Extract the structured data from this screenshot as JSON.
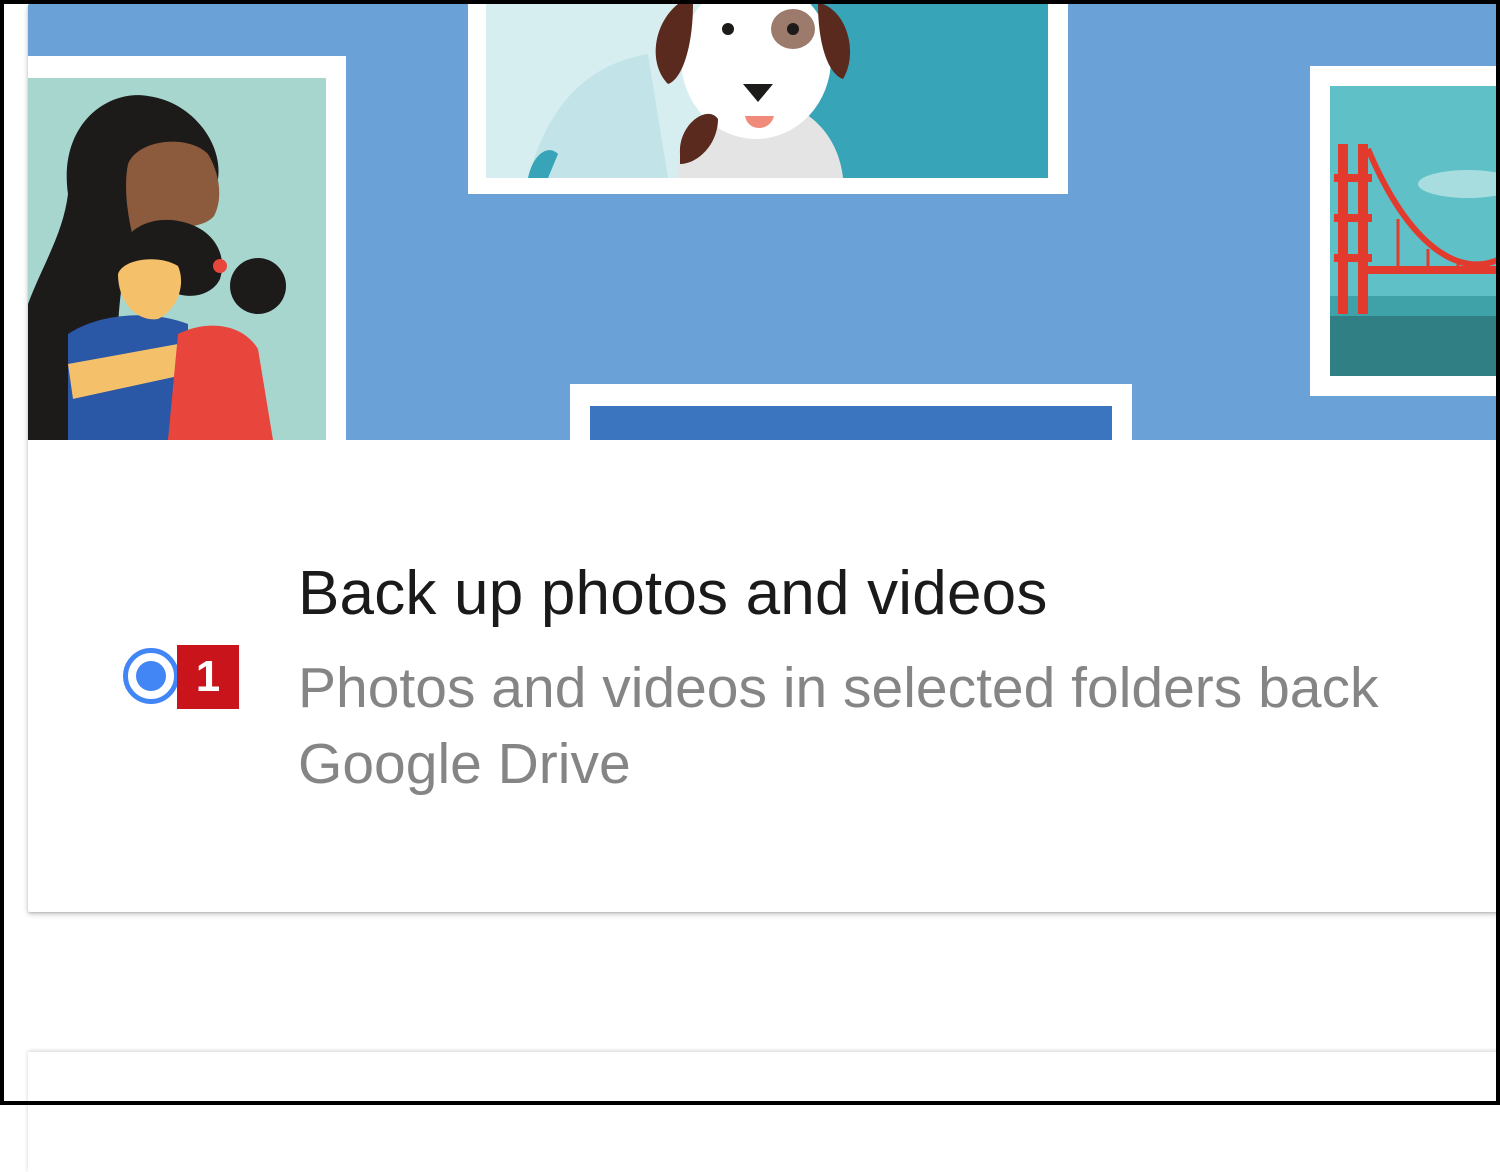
{
  "backup_option": {
    "title": "Back up photos and videos",
    "description_line1": "Photos and videos in selected folders back",
    "description_line2": "Google Drive",
    "selected": true,
    "step_number": "1"
  },
  "hero": {
    "illustration": "photo-collage-illustration",
    "background_color": "#6aa2d8"
  },
  "colors": {
    "radio_accent": "#4285f4",
    "step_badge": "#c8141a",
    "title_text": "#1a1a1a",
    "description_text": "#858585"
  }
}
